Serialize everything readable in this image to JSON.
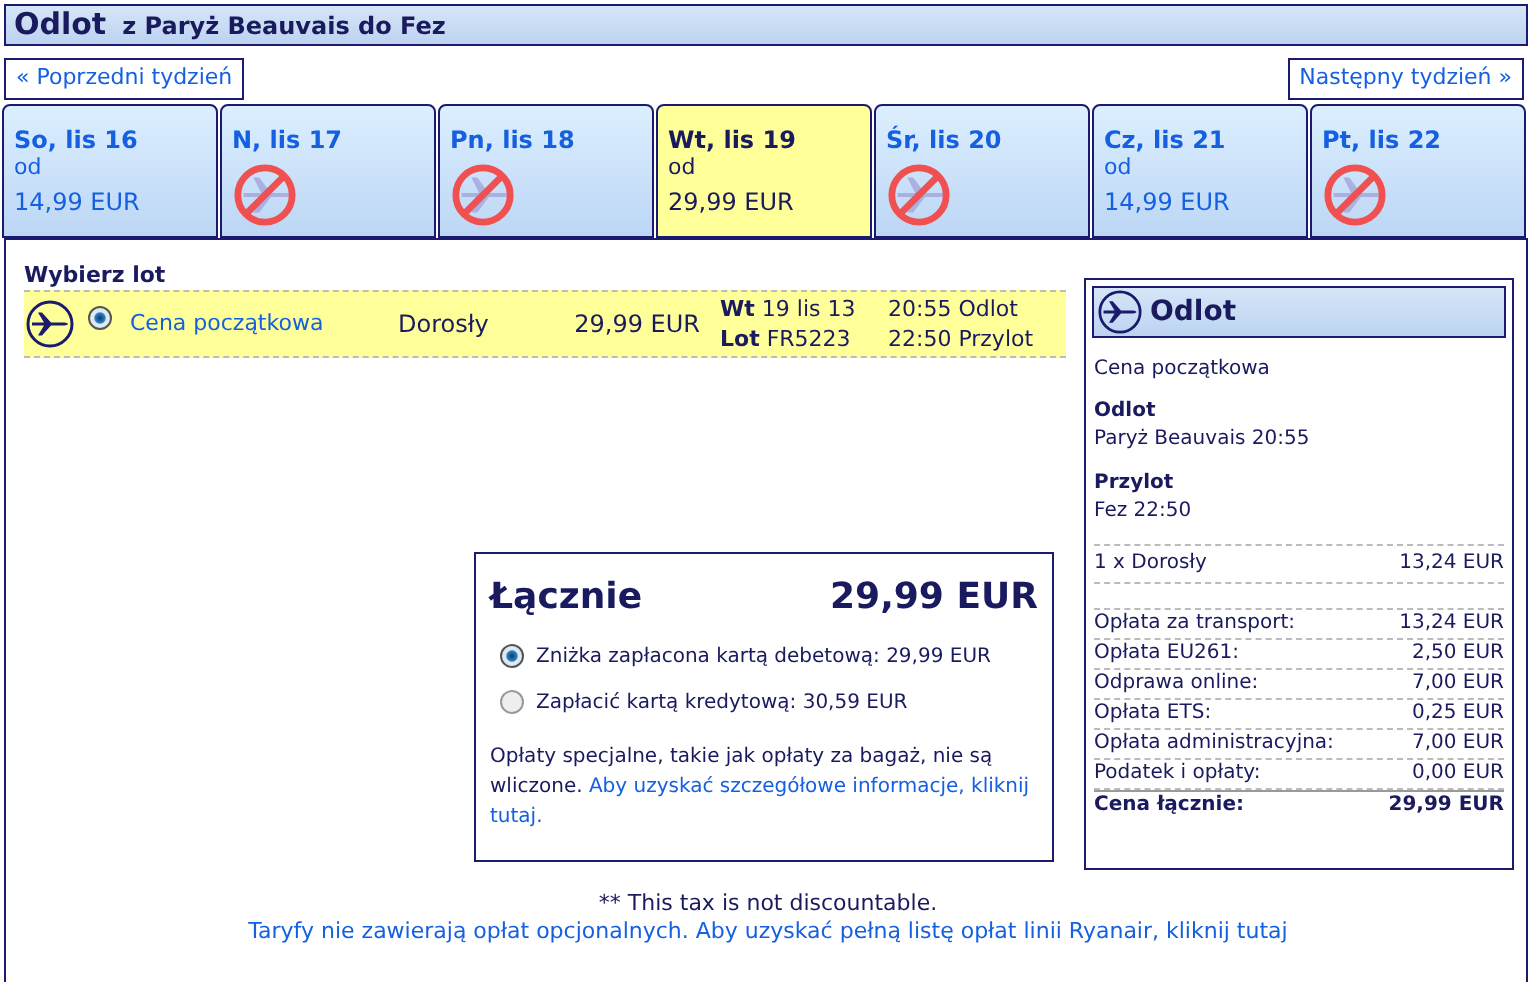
{
  "header": {
    "title": "Odlot",
    "route": "z Paryż Beauvais do Fez"
  },
  "nav": {
    "prev": "« Poprzedni tydzień",
    "next": "Następny tydzień »"
  },
  "days": [
    {
      "label": "So, lis 16",
      "selected": false,
      "kind": "fare",
      "from": "od",
      "price": "14,99 EUR"
    },
    {
      "label": "N, lis 17",
      "selected": false,
      "kind": "none"
    },
    {
      "label": "Pn, lis 18",
      "selected": false,
      "kind": "none"
    },
    {
      "label": "Wt, lis 19",
      "selected": true,
      "kind": "fare",
      "from": "od",
      "price": "29,99 EUR"
    },
    {
      "label": "Śr, lis 20",
      "selected": false,
      "kind": "none"
    },
    {
      "label": "Cz, lis 21",
      "selected": false,
      "kind": "fare",
      "from": "od",
      "price": "14,99 EUR"
    },
    {
      "label": "Pt, lis 22",
      "selected": false,
      "kind": "none"
    }
  ],
  "flights": {
    "heading": "Wybierz lot",
    "rows": [
      {
        "selected": true,
        "fare": "Cena początkowa",
        "passenger": "Dorosły",
        "price": "29,99 EUR",
        "day_label": "Wt",
        "date": "19 lis 13",
        "flight_label": "Lot",
        "flight_no": "FR5223",
        "departure": "20:55 Odlot",
        "arrival": "22:50 Przylot"
      }
    ]
  },
  "summary": {
    "title": "Odlot",
    "fare": "Cena początkowa",
    "departure_label": "Odlot",
    "departure": "Paryż Beauvais 20:55",
    "arrival_label": "Przylot",
    "arrival": "Fez 22:50",
    "passengers": [
      {
        "label": "1 x Dorosły",
        "amount": "13,24 EUR"
      }
    ],
    "fees": [
      {
        "label": "Opłata za transport:",
        "amount": "13,24 EUR"
      },
      {
        "label": "Opłata EU261:",
        "amount": "2,50 EUR"
      },
      {
        "label": "Odprawa online:",
        "amount": "7,00 EUR"
      },
      {
        "label": "Opłata ETS:",
        "amount": "0,25 EUR"
      },
      {
        "label": "Opłata administracyjna:",
        "amount": "7,00 EUR"
      },
      {
        "label": "Podatek i opłaty:",
        "amount": "0,00 EUR"
      }
    ],
    "total": {
      "label": "Cena łącznie:",
      "amount": "29,99 EUR"
    }
  },
  "total_box": {
    "label": "Łącznie",
    "amount": "29,99 EUR",
    "options": [
      {
        "label": "Zniżka zapłacona kartą debetową: 29,99 EUR",
        "selected": true
      },
      {
        "label": "Zapłacić kartą kredytową: 30,59 EUR",
        "selected": false
      }
    ],
    "note": "Opłaty specjalne, takie jak opłaty za bagaż, nie są wliczone.",
    "note_link": "Aby uzyskać szczegółowe informacje, kliknij tutaj."
  },
  "footer": {
    "tax_note": "** This tax is not discountable.",
    "link": "Taryfy nie zawierają opłat opcjonalnych. Aby uzyskać pełną listę opłat linii Ryanair, kliknij tutaj"
  }
}
